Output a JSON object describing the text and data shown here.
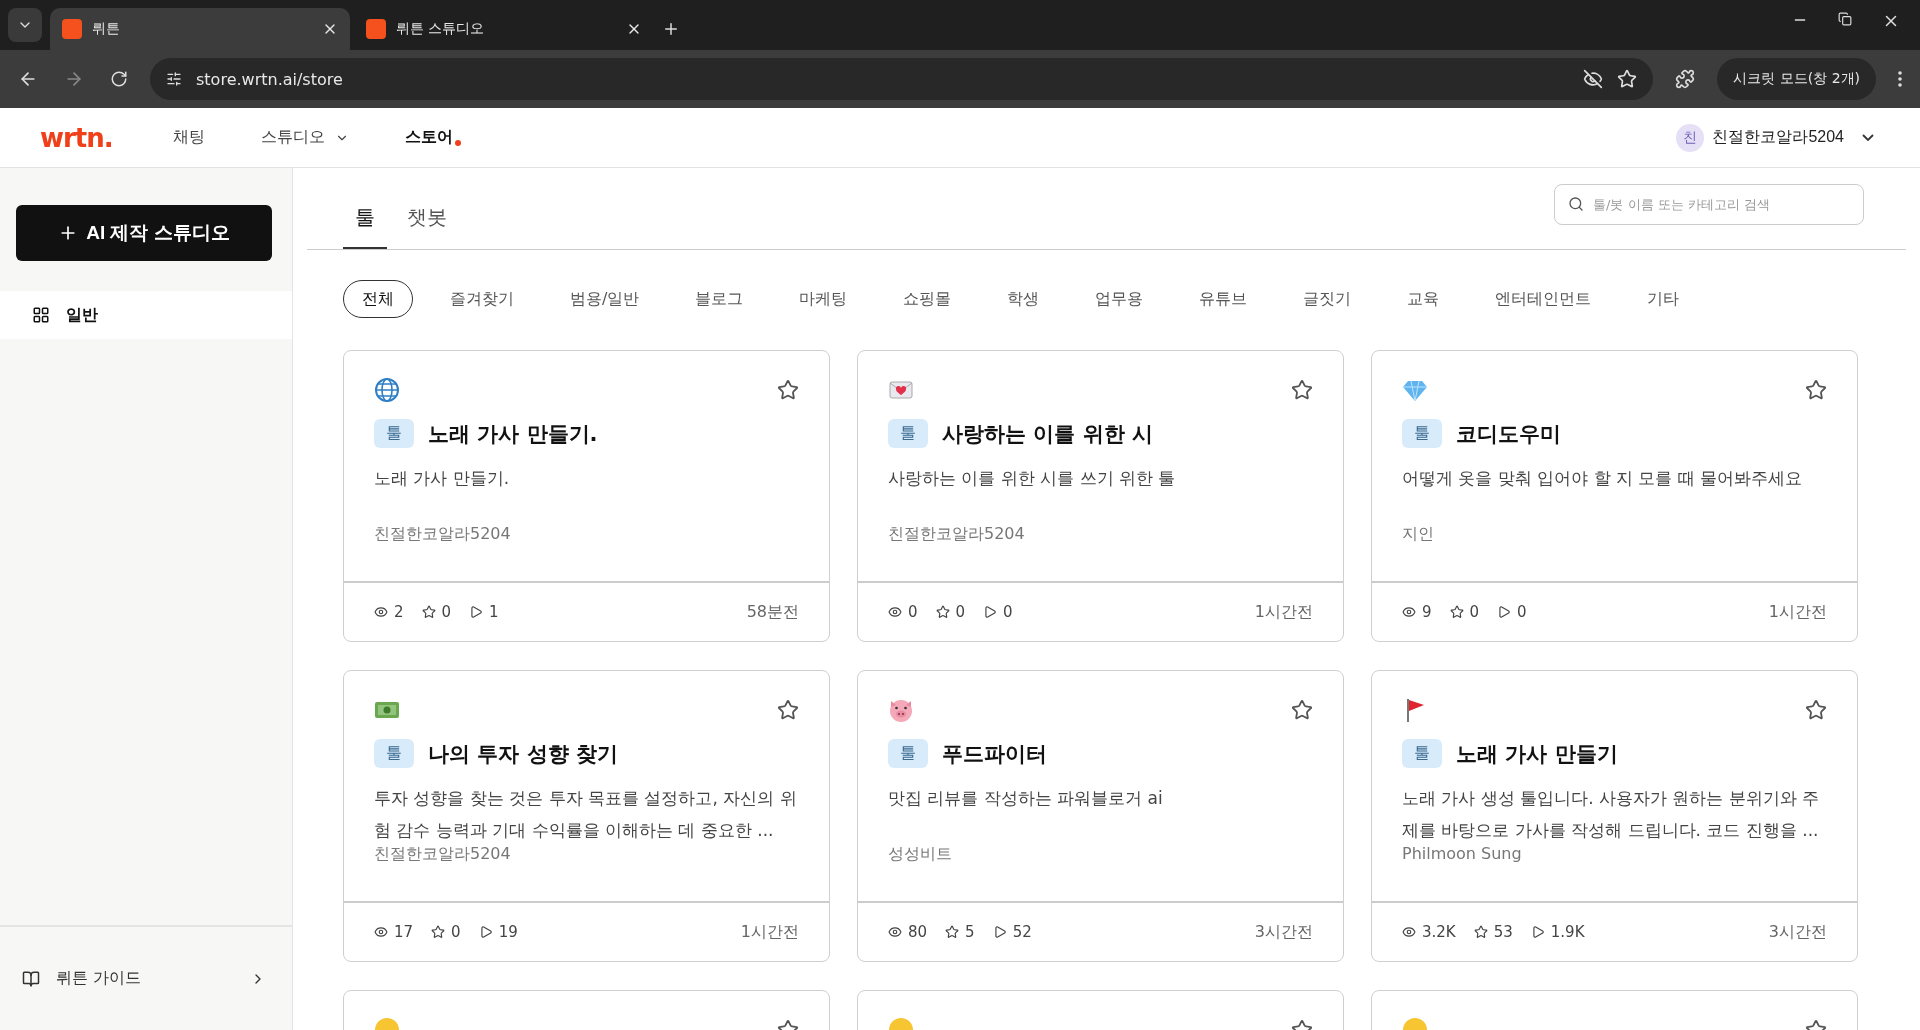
{
  "browser": {
    "tabs": [
      {
        "title": "뤼튼",
        "selected": true
      },
      {
        "title": "뤼튼 스튜디오",
        "selected": false
      }
    ],
    "url": "store.wrtn.ai/store",
    "incognito": "시크릿 모드(창 2개)"
  },
  "header": {
    "logo": "wrtn.",
    "nav": [
      {
        "label": "채팅",
        "selected": false,
        "dropdown": false
      },
      {
        "label": "스튜디오",
        "selected": false,
        "dropdown": true
      },
      {
        "label": "스토어",
        "selected": true,
        "dropdown": false
      }
    ],
    "avatar": "친",
    "user": "친절한코알라5204"
  },
  "sidebar": {
    "create_button": "AI 제작 스튜디오",
    "items": [
      {
        "label": "일반",
        "selected": true
      }
    ],
    "guide": "뤼튼 가이드"
  },
  "tabs": [
    {
      "label": "툴",
      "selected": true
    },
    {
      "label": "챗봇",
      "selected": false
    }
  ],
  "search": {
    "placeholder": "툴/봇 이름 또는 카테고리 검색"
  },
  "filters": [
    {
      "label": "전체",
      "selected": true
    },
    {
      "label": "즐겨찾기",
      "selected": false
    },
    {
      "label": "범용/일반",
      "selected": false
    },
    {
      "label": "블로그",
      "selected": false
    },
    {
      "label": "마케팅",
      "selected": false
    },
    {
      "label": "쇼핑몰",
      "selected": false
    },
    {
      "label": "학생",
      "selected": false
    },
    {
      "label": "업무용",
      "selected": false
    },
    {
      "label": "유튜브",
      "selected": false
    },
    {
      "label": "글짓기",
      "selected": false
    },
    {
      "label": "교육",
      "selected": false
    },
    {
      "label": "엔터테인먼트",
      "selected": false
    },
    {
      "label": "기타",
      "selected": false
    }
  ],
  "cards": [
    {
      "kind": "tool",
      "badge": "툴",
      "title": "노래 가사 만들기.",
      "description": "노래 가사 만들기.",
      "author": "친절한코알라5204",
      "views": "2",
      "stars": "0",
      "runs": "1",
      "time": "58분전"
    },
    {
      "kind": "tool",
      "badge": "툴",
      "title": "사랑하는 이를 위한 시",
      "description": "사랑하는 이를 위한 시를 쓰기 위한 툴",
      "author": "친절한코알라5204",
      "views": "0",
      "stars": "0",
      "runs": "0",
      "time": "1시간전"
    },
    {
      "kind": "tool",
      "badge": "툴",
      "title": "코디도우미",
      "description": "어떻게 옷을 맞춰 입어야 할 지 모를 때 물어봐주세요",
      "author": "지인",
      "views": "9",
      "stars": "0",
      "runs": "0",
      "time": "1시간전"
    },
    {
      "kind": "tool",
      "badge": "툴",
      "title": "나의 투자 성향 찾기",
      "description": "투자 성향을 찾는 것은 투자 목표를 설정하고, 자신의 위험 감수 능력과 기대 수익률을 이해하는 데 중요한 ...",
      "author": "친절한코알라5204",
      "views": "17",
      "stars": "0",
      "runs": "19",
      "time": "1시간전"
    },
    {
      "kind": "tool",
      "badge": "툴",
      "title": "푸드파이터",
      "description": "맛집 리뷰를 작성하는 파워블로거 ai",
      "author": "성성비트",
      "views": "80",
      "stars": "5",
      "runs": "52",
      "time": "3시간전"
    },
    {
      "kind": "tool",
      "badge": "툴",
      "title": "노래 가사 만들기",
      "description": "노래 가사 생성 툴입니다. 사용자가 원하는 분위기와 주제를 바탕으로 가사를 작성해 드립니다. 코드 진행을 ...",
      "author": "Philmoon Sung",
      "views": "3.2K",
      "stars": "53",
      "runs": "1.9K",
      "time": "3시간전"
    },
    {
      "kind": "cut"
    },
    {
      "kind": "cut"
    },
    {
      "kind": "cut"
    }
  ]
}
